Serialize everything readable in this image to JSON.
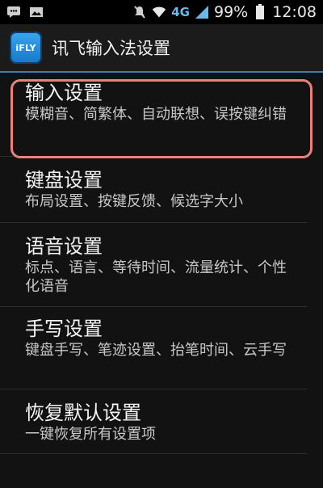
{
  "status": {
    "network_type": "4G",
    "battery": "99%",
    "time": "12:08",
    "icons": [
      "message-icon",
      "image-icon",
      "mute-icon",
      "wifi-icon",
      "signal-icon",
      "battery-icon"
    ]
  },
  "app": {
    "icon_text": "iFLY",
    "title": "讯飞输入法设置"
  },
  "settings": [
    {
      "title": "输入设置",
      "summary": "模糊音、简繁体、自动联想、误按键纠错"
    },
    {
      "title": "键盘设置",
      "summary": "布局设置、按键反馈、候选字大小"
    },
    {
      "title": "语音设置",
      "summary": "标点、语言、等待时间、流量统计、个性化语音"
    },
    {
      "title": "手写设置",
      "summary": "键盘手写、笔迹设置、抬笔时间、云手写"
    },
    {
      "title": "恢复默认设置",
      "summary": "一键恢复所有设置项"
    }
  ],
  "colors": {
    "accent": "#3a7fae",
    "highlight": "#e9827d",
    "background": "#121212"
  }
}
